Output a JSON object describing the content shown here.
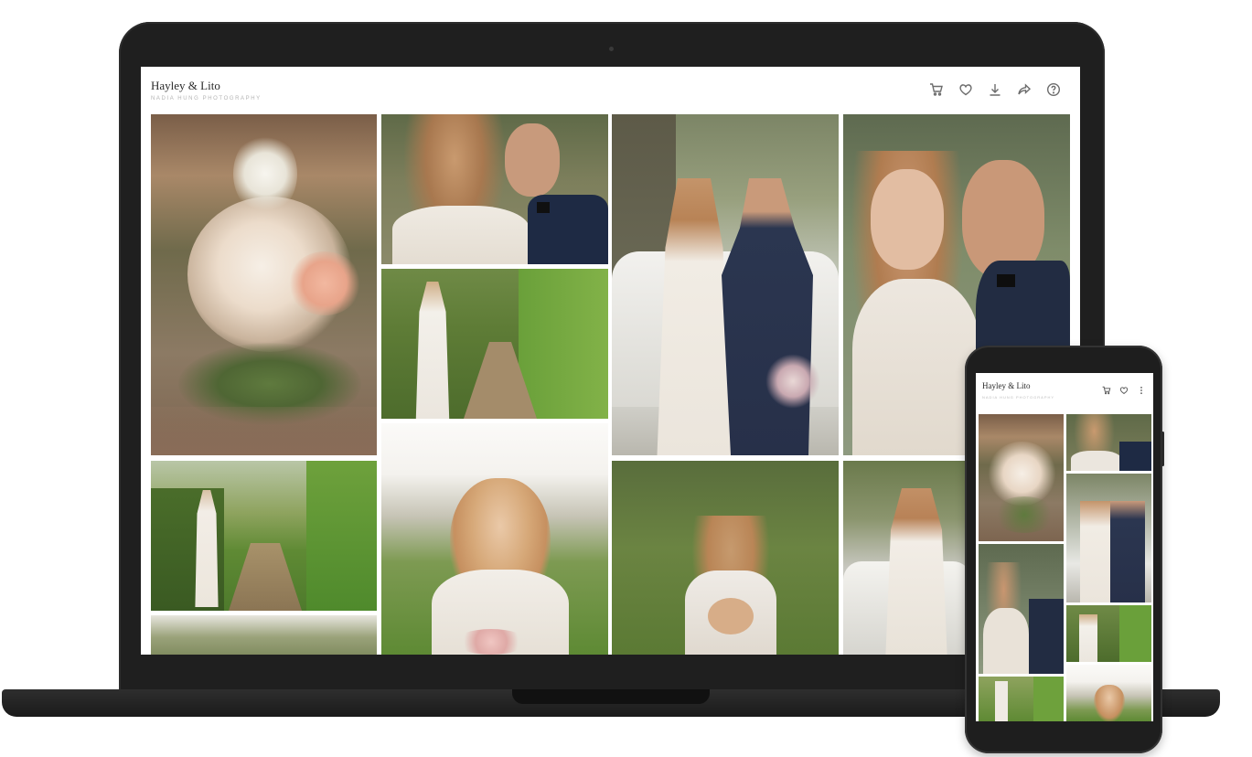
{
  "gallery": {
    "title": "Hayley & Lito",
    "subtitle": "NADIA HUNG PHOTOGRAPHY"
  },
  "header_icons": [
    "cart-icon",
    "heart-icon",
    "download-icon",
    "share-icon",
    "help-icon"
  ],
  "mobile": {
    "title": "Hayley & Lito",
    "subtitle": "NADIA HUNG PHOTOGRAPHY",
    "icons": [
      "cart-icon",
      "heart-icon",
      "more-vertical-icon"
    ]
  },
  "photos": [
    "flower-centerpiece",
    "couple-closeup",
    "bride-vineyard",
    "couple-car-embrace",
    "couple-closeup-large",
    "bride-vineyard-row",
    "bride-bouquet",
    "bride-back-vineyard",
    "bride-car",
    "couple-partial"
  ],
  "colors": {
    "device_body": "#1f1f1f",
    "icon_gray": "#6c6c6c",
    "subtitle_gray": "#b4b4b4"
  }
}
